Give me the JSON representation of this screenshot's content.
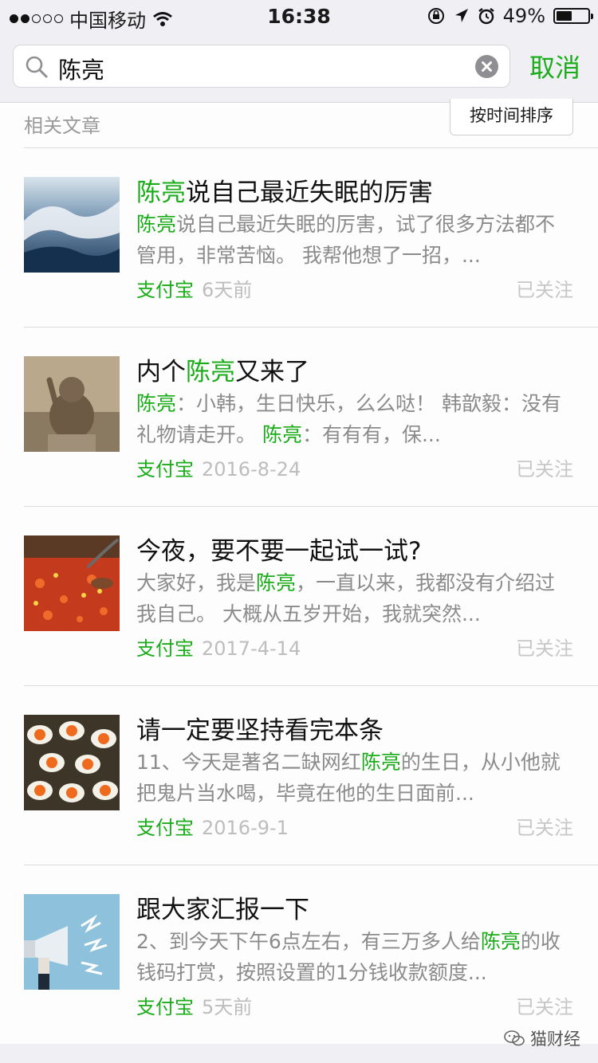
{
  "status_bar": {
    "carrier": "中国移动",
    "time": "16:38",
    "battery": "49%",
    "battery_level": 0.49
  },
  "search": {
    "query": "陈亮",
    "cancel_label": "取消"
  },
  "section": {
    "label": "相关文章",
    "sort_label": "按时间排序"
  },
  "articles": [
    {
      "title": [
        {
          "t": "陈亮",
          "hl": true
        },
        {
          "t": "说自己最近失眠的厉害",
          "hl": false
        }
      ],
      "snippet": [
        {
          "t": "陈亮",
          "hl": true
        },
        {
          "t": "说自己最近失眠的厉害，试了很多方法都不管用，非常苦恼。 我帮他想了一招，...",
          "hl": false
        }
      ],
      "source": "支付宝",
      "date": "6天前",
      "follow": "已关注",
      "thumb": "wave"
    },
    {
      "title": [
        {
          "t": "内个",
          "hl": false
        },
        {
          "t": "陈亮",
          "hl": true
        },
        {
          "t": "又来了",
          "hl": false
        }
      ],
      "snippet": [
        {
          "t": "陈亮",
          "hl": true
        },
        {
          "t": "：小韩，生日快乐，么么哒！ 韩歆毅：没有礼物请走开。 ",
          "hl": false
        },
        {
          "t": "陈亮",
          "hl": true
        },
        {
          "t": "：有有有，保...",
          "hl": false
        }
      ],
      "source": "支付宝",
      "date": "2016-8-24",
      "follow": "已关注",
      "thumb": "marmot"
    },
    {
      "title": [
        {
          "t": "今夜，要不要一起试一试?",
          "hl": false
        }
      ],
      "snippet": [
        {
          "t": "大家好，我是",
          "hl": false
        },
        {
          "t": "陈亮",
          "hl": true
        },
        {
          "t": "，一直以来，我都没有介绍过我自己。 大概从五岁开始，我就突然...",
          "hl": false
        }
      ],
      "source": "支付宝",
      "date": "2017-4-14",
      "follow": "已关注",
      "thumb": "peppers"
    },
    {
      "title": [
        {
          "t": "请一定要坚持看完本条",
          "hl": false
        }
      ],
      "snippet": [
        {
          "t": "11、今天是著名二缺网红",
          "hl": false
        },
        {
          "t": "陈亮",
          "hl": true
        },
        {
          "t": "的生日，从小他就把鬼片当水喝，毕竟在他的生日面前...",
          "hl": false
        }
      ],
      "source": "支付宝",
      "date": "2016-9-1",
      "follow": "已关注",
      "thumb": "eggs"
    },
    {
      "title": [
        {
          "t": "跟大家汇报一下",
          "hl": false
        }
      ],
      "snippet": [
        {
          "t": "2、到今天下午6点左右，有三万多人给",
          "hl": false
        },
        {
          "t": "陈亮",
          "hl": true
        },
        {
          "t": "的收钱码打赏，按照设置的1分钱收款额度...",
          "hl": false
        }
      ],
      "source": "支付宝",
      "date": "5天前",
      "follow": "已关注",
      "thumb": "megaphone"
    }
  ],
  "watermark": {
    "text": "猫财经"
  },
  "colors": {
    "accent": "#1aad19",
    "muted": "#8b8b8b",
    "follow": "#c7c7c7"
  }
}
